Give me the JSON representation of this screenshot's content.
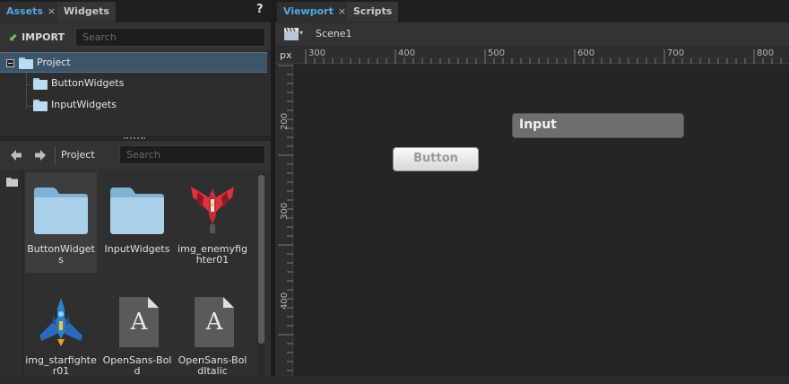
{
  "assets_panel": {
    "tabs": [
      {
        "label": "Assets",
        "close": "×"
      },
      {
        "label": "Widgets"
      }
    ],
    "help": "?",
    "import_label": "IMPORT",
    "search_placeholder": "Search",
    "tree": [
      {
        "label": "Project"
      },
      {
        "label": "ButtonWidgets"
      },
      {
        "label": "InputWidgets"
      }
    ],
    "breadcrumb": "Project",
    "browser_search_placeholder": "Search",
    "items": [
      {
        "label": "ButtonWidgets",
        "icon": "folder-icon"
      },
      {
        "label": "InputWidgets",
        "icon": "folder-icon"
      },
      {
        "label": "img_enemyfighter01",
        "icon": "enemy-fighter-image-icon"
      },
      {
        "label": "img_starfighter01",
        "icon": "starfighter-image-icon"
      },
      {
        "label": "OpenSans-Bold",
        "icon": "font-file-icon"
      },
      {
        "label": "OpenSans-BoldItalic",
        "icon": "font-file-icon"
      }
    ],
    "font_glyph": "A"
  },
  "viewport_panel": {
    "tabs": [
      {
        "label": "Viewport",
        "close": "×"
      },
      {
        "label": "Scripts"
      }
    ],
    "scene": "Scene1",
    "ruler_unit": "px",
    "ruler_top": [
      "300",
      "400",
      "500",
      "600",
      "700",
      "800"
    ],
    "ruler_left": [
      "200",
      "300",
      "400"
    ],
    "widgets": {
      "button_label": "Button",
      "input_label": "Input"
    }
  },
  "colors": {
    "accent_tab": "#4fa8e8",
    "selection": "#3b566b",
    "folder": "#b9dcf2"
  }
}
